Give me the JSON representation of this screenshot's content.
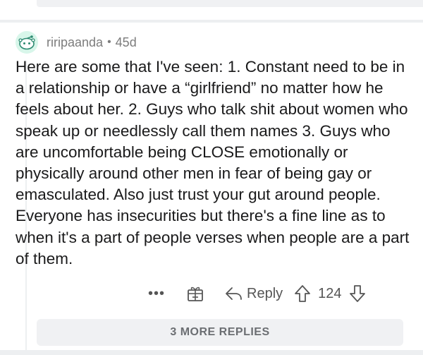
{
  "comment": {
    "username": "riripaanda",
    "separator": "•",
    "age": "45d",
    "body": "Here are some that I've seen: 1. Constant need to be in a relationship or have a “girlfriend” no matter how he feels about her. 2. Guys who talk shit about women who speak up or needlessly call them names 3. Guys who are uncomfortable being CLOSE emotionally or physically around other men in fear of being gay or emasculated. Also just trust your gut around people. Everyone has insecurities but there's a fine line as to when it's a part of people verses when people are a part of them."
  },
  "actions": {
    "more_label": "•••",
    "reply_label": "Reply",
    "vote_count": "124"
  },
  "more_replies_label": "3 MORE REPLIES",
  "colors": {
    "avatar_bg": "#d8f6ea",
    "avatar_accent": "#2e8b72",
    "meta_text": "#7c7c7c",
    "action_text": "#555555"
  }
}
